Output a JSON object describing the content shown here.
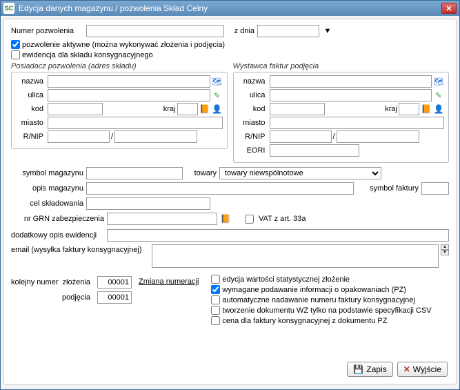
{
  "window": {
    "title": "Edycja danych magazynu / pozwolenia Skład Celny",
    "app_icon_text": "SC"
  },
  "top": {
    "permit_number_label": "Numer pozwolenia",
    "date_label": "z dnia",
    "chk_active": "pozwolenie aktywne (można wykonywać złożenia i podjęcia)",
    "chk_consign": "ewidencja dla składu konsygnacyjnego"
  },
  "holder": {
    "title": "Posiadacz pozwolenia (adres składu)",
    "labels": {
      "name": "nazwa",
      "street": "ulica",
      "code": "kod",
      "country": "kraj",
      "city": "miasto",
      "rnip": "R/NIP"
    }
  },
  "issuer": {
    "title": "Wystawca faktur podjęcia",
    "labels": {
      "name": "nazwa",
      "street": "ulica",
      "code": "kod",
      "country": "kraj",
      "city": "miasto",
      "rnip": "R/NIP",
      "eori": "EORI"
    }
  },
  "mid": {
    "symbol_label": "symbol magazynu",
    "goods_label": "towary",
    "goods_selected": "towary niewspólnotowe",
    "desc_label": "opis magazynu",
    "invoice_symbol_label": "symbol faktury",
    "purpose_label": "cel składowania",
    "grn_label": "nr GRN zabezpieczenia",
    "vat33a": "VAT z art. 33a",
    "extra_desc_label": "dodatkowy opis ewidencji",
    "email_label": "email (wysyłka faktury konsygnacyjnej)"
  },
  "numbering": {
    "header": "kolejny numer",
    "deposit_label": "złożenia",
    "withdraw_label": "podjęcia",
    "deposit_value": "00001",
    "withdraw_value": "00001",
    "change_link": "Zmiana numeracji"
  },
  "options": {
    "opt1": "edycja wartości statystycznej złożenie",
    "opt2": "wymagane podawanie informacji o opakowaniach (PZ)",
    "opt3": "automatyczne nadawanie numeru faktury konsygnacyjnej",
    "opt4": "tworzenie dokumentu WZ tylko na podstawie specyfikacji CSV",
    "opt5": "cena dla faktury konsygnacyjnej z dokumentu PZ"
  },
  "buttons": {
    "save": "Zapis",
    "exit": "Wyjście"
  }
}
